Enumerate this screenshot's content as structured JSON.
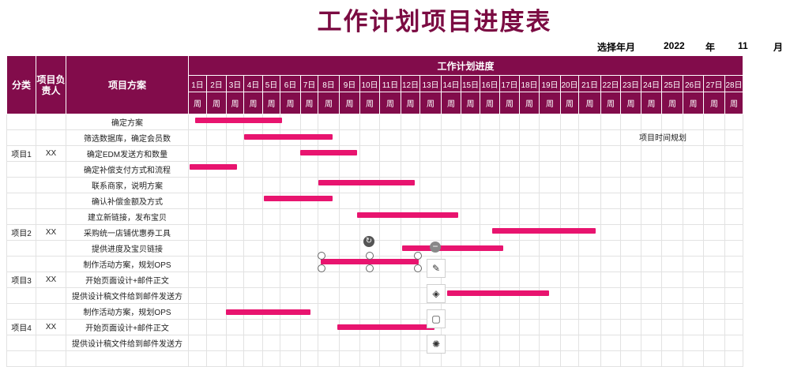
{
  "title": "工作计划项目进度表",
  "select": {
    "label": "选择年月",
    "year": "2022",
    "year_unit": "年",
    "month": "11",
    "month_unit": "月"
  },
  "header": {
    "category": "分类",
    "owner": "项目负责人",
    "plan": "项目方案",
    "progress": "工作计划进度",
    "days": [
      "1日",
      "2日",
      "3日",
      "4日",
      "5日",
      "6日",
      "7日",
      "8日",
      "9日",
      "10日",
      "11日",
      "12日",
      "13日",
      "14日",
      "15日",
      "16日",
      "17日",
      "18日",
      "19日",
      "20日",
      "21日",
      "22日",
      "23日",
      "24日",
      "25日",
      "26日",
      "27日",
      "28日"
    ],
    "weeks": [
      "周",
      "周",
      "周",
      "周",
      "周",
      "周",
      "周",
      "周",
      "周",
      "周",
      "周",
      "周",
      "周",
      "周",
      "周",
      "周",
      "周",
      "周",
      "周",
      "周",
      "周",
      "周",
      "周",
      "周",
      "周",
      "周",
      "周",
      "周"
    ]
  },
  "rows": [
    {
      "cat": "",
      "owner": "",
      "plan": "确定方案"
    },
    {
      "cat": "",
      "owner": "",
      "plan": "筛选数据库，确定会员数"
    },
    {
      "cat": "项目1",
      "owner": "XX",
      "plan": "确定EDM发送方和数量"
    },
    {
      "cat": "",
      "owner": "",
      "plan": "确定补偿支付方式和流程"
    },
    {
      "cat": "",
      "owner": "",
      "plan": "联系商家，说明方案"
    },
    {
      "cat": "",
      "owner": "",
      "plan": "确认补偿金额及方式"
    },
    {
      "cat": "",
      "owner": "",
      "plan": "建立新链接，发布宝贝"
    },
    {
      "cat": "项目2",
      "owner": "XX",
      "plan": "采购统一店铺优惠券工具"
    },
    {
      "cat": "",
      "owner": "",
      "plan": "提供进度及宝贝链接"
    },
    {
      "cat": "",
      "owner": "",
      "plan": "制作活动方案，规划OPS"
    },
    {
      "cat": "项目3",
      "owner": "XX",
      "plan": "开始页面设计+邮件正文"
    },
    {
      "cat": "",
      "owner": "",
      "plan": "提供设计稿文件给到邮件发送方"
    },
    {
      "cat": "",
      "owner": "",
      "plan": "制作活动方案，规划OPS"
    },
    {
      "cat": "项目4",
      "owner": "XX",
      "plan": "开始页面设计+邮件正文"
    },
    {
      "cat": "",
      "owner": "",
      "plan": "提供设计稿文件给到邮件发送方"
    }
  ],
  "legend_note": "项目时间规划",
  "colors": {
    "header_bg": "#820c4b",
    "bar": "#e8146f",
    "title": "#7b0b42"
  },
  "icons": [
    "rotate-icon",
    "minus-icon",
    "pen-icon",
    "fill-icon",
    "frame-icon",
    "effects-icon"
  ]
}
